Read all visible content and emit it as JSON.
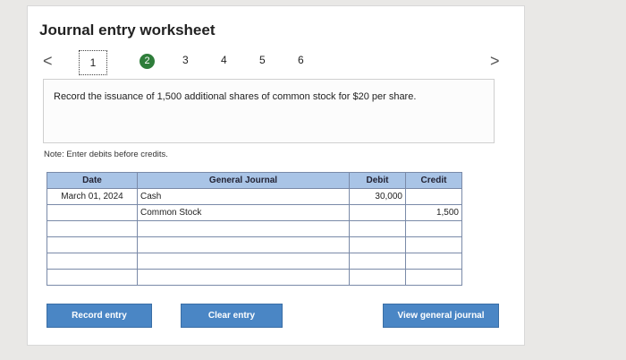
{
  "title": "Journal entry worksheet",
  "nav": {
    "prev": "<",
    "next": ">",
    "steps": [
      "1",
      "2",
      "3",
      "4",
      "5",
      "6"
    ]
  },
  "prompt": "Record the issuance of 1,500 additional shares of common stock for $20 per share.",
  "note": "Note: Enter debits before credits.",
  "journal": {
    "headers": {
      "date": "Date",
      "account": "General Journal",
      "debit": "Debit",
      "credit": "Credit"
    },
    "rows": [
      {
        "date": "March 01, 2024",
        "account": "Cash",
        "debit": "30,000",
        "credit": ""
      },
      {
        "date": "",
        "account": "Common Stock",
        "debit": "",
        "credit": "1,500"
      },
      {
        "date": "",
        "account": "",
        "debit": "",
        "credit": ""
      },
      {
        "date": "",
        "account": "",
        "debit": "",
        "credit": ""
      },
      {
        "date": "",
        "account": "",
        "debit": "",
        "credit": ""
      },
      {
        "date": "",
        "account": "",
        "debit": "",
        "credit": ""
      }
    ]
  },
  "buttons": {
    "record": "Record entry",
    "clear": "Clear entry",
    "view": "View general journal"
  },
  "colors": {
    "accent": "#4a86c5",
    "header": "#a9c4e6",
    "current_step": "#2e7d3a"
  }
}
